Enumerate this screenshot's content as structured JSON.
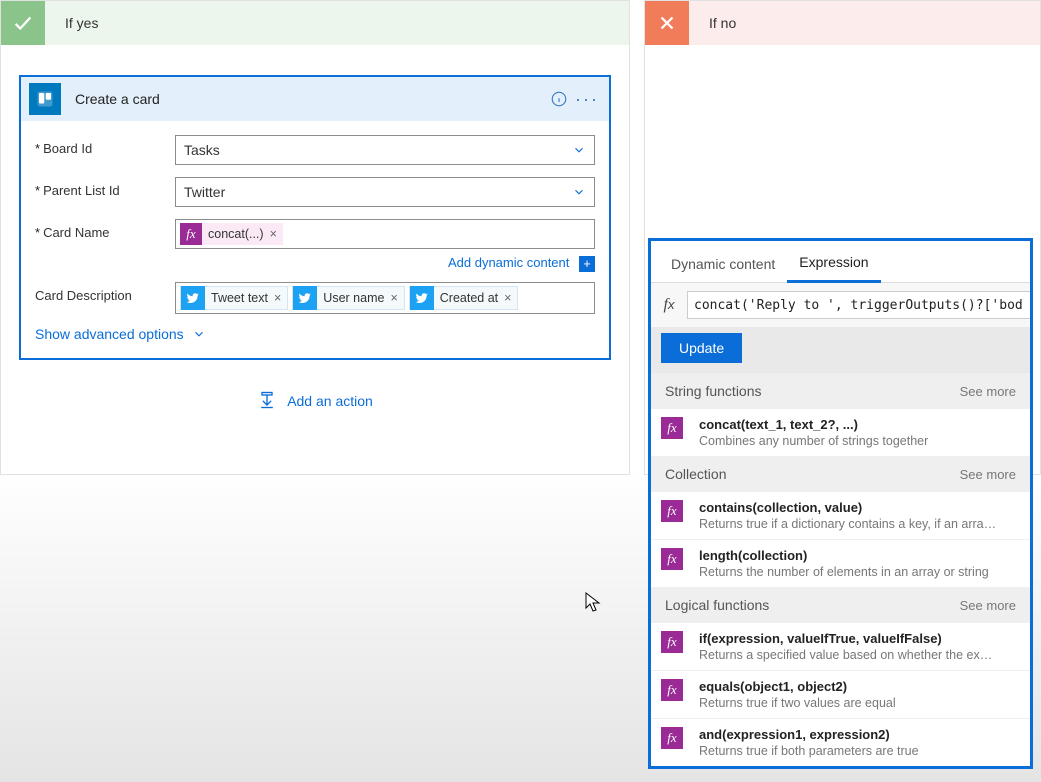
{
  "branches": {
    "if_yes_title": "If yes",
    "if_no_title": "If no"
  },
  "card": {
    "title": "Create a card",
    "fields": {
      "board_id": {
        "label": "Board Id",
        "value": "Tasks"
      },
      "parent_list_id": {
        "label": "Parent List Id",
        "value": "Twitter"
      },
      "card_name": {
        "label": "Card Name",
        "token": "concat(...)"
      },
      "card_description": {
        "label": "Card Description",
        "tokens": [
          "Tweet text",
          "User name",
          "Created at"
        ]
      }
    },
    "add_dynamic_content": "Add dynamic content",
    "show_advanced": "Show advanced options"
  },
  "add_action_label": "Add an action",
  "expression_panel": {
    "tabs": {
      "dynamic": "Dynamic content",
      "expression": "Expression"
    },
    "input_value": "concat('Reply to ', triggerOutputs()?['bod",
    "update_label": "Update",
    "see_more_label": "See more",
    "sections": [
      {
        "title": "String functions",
        "items": [
          {
            "sig": "concat(text_1, text_2?, ...)",
            "desc": "Combines any number of strings together"
          }
        ]
      },
      {
        "title": "Collection",
        "items": [
          {
            "sig": "contains(collection, value)",
            "desc": "Returns true if a dictionary contains a key, if an array cont..."
          },
          {
            "sig": "length(collection)",
            "desc": "Returns the number of elements in an array or string"
          }
        ]
      },
      {
        "title": "Logical functions",
        "items": [
          {
            "sig": "if(expression, valueIfTrue, valueIfFalse)",
            "desc": "Returns a specified value based on whether the expressio..."
          },
          {
            "sig": "equals(object1, object2)",
            "desc": "Returns true if two values are equal"
          },
          {
            "sig": "and(expression1, expression2)",
            "desc": "Returns true if both parameters are true"
          }
        ]
      }
    ]
  }
}
